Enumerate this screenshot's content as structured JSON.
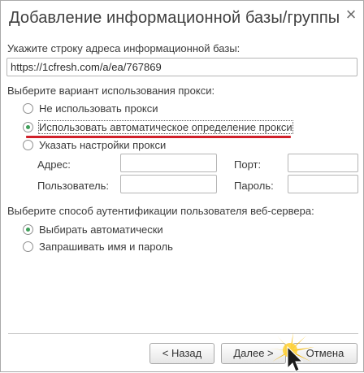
{
  "dialog": {
    "title": "Добавление информационной базы/группы",
    "close_glyph": "×"
  },
  "address": {
    "label": "Укажите строку адреса информационной базы:",
    "value": "https://1cfresh.com/a/ea/767869"
  },
  "proxy": {
    "label": "Выберите вариант использования прокси:",
    "options": [
      {
        "label": "Не использовать прокси",
        "checked": false
      },
      {
        "label": "Использовать автоматическое определение прокси",
        "checked": true
      },
      {
        "label": "Указать настройки прокси",
        "checked": false
      }
    ],
    "fields": {
      "address_label": "Адрес:",
      "port_label": "Порт:",
      "user_label": "Пользователь:",
      "password_label": "Пароль:",
      "address_value": "",
      "port_value": "",
      "user_value": "",
      "password_value": ""
    }
  },
  "auth": {
    "label": "Выберите способ аутентификации пользователя веб-сервера:",
    "options": [
      {
        "label": "Выбирать автоматически",
        "checked": true
      },
      {
        "label": "Запрашивать имя и пароль",
        "checked": false
      }
    ]
  },
  "buttons": {
    "back": "< Назад",
    "next": "Далее >",
    "cancel": "Отмена"
  },
  "colors": {
    "annotation": "#d0202a",
    "radio_dot": "#3f9f5a",
    "cursor_glow": "#f5b800"
  },
  "icons": {
    "close": "close-icon",
    "cursor": "mouse-pointer-icon"
  }
}
